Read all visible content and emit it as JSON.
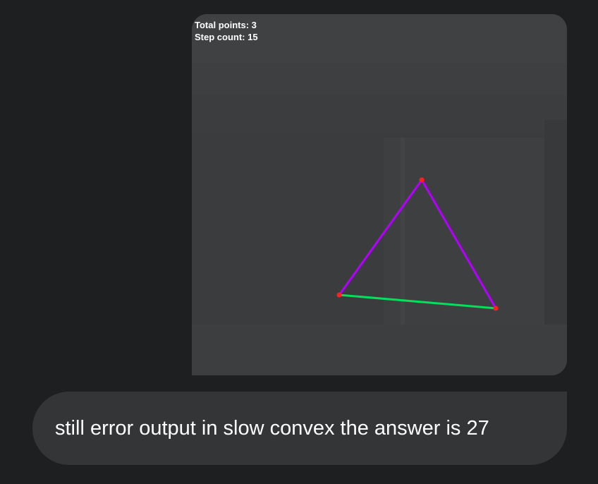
{
  "image_card": {
    "overlay": {
      "total_points": "Total points: 3",
      "step_count": "Step count: 15"
    },
    "visualization": {
      "point_color": "#ff2020",
      "hull_color": "#b400ff",
      "edge_color": "#00e05a"
    }
  },
  "message": {
    "text": "still error output in slow convex the answer is 27"
  },
  "colors": {
    "page_background": "#1e1f21",
    "bubble_background": "#333537",
    "card_background": "#3c3d3f"
  }
}
